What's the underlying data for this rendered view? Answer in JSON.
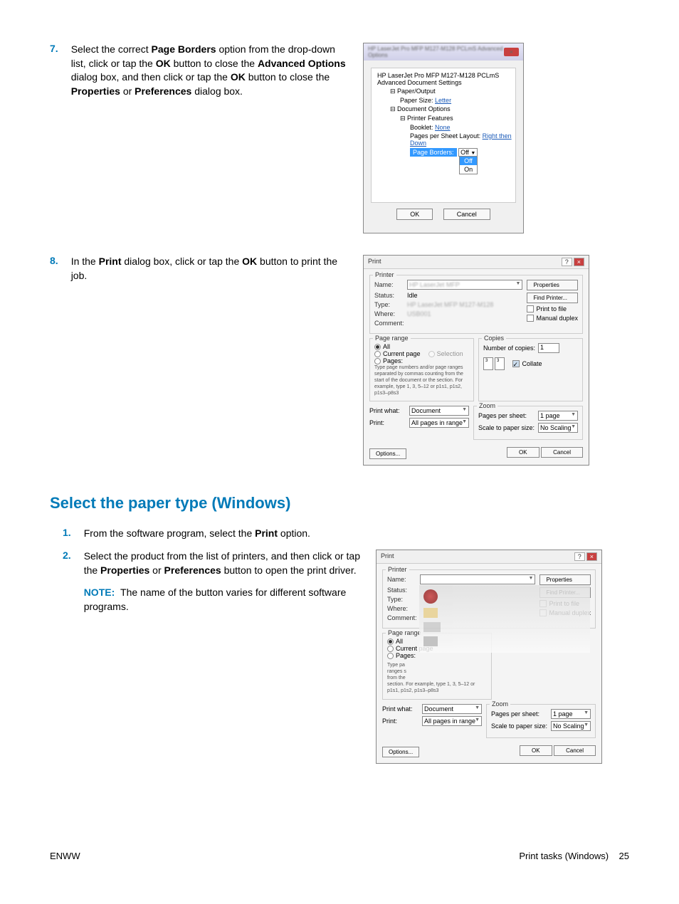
{
  "step7": {
    "number": "7.",
    "text_parts": [
      "Select the correct ",
      "Page Borders",
      " option from the drop-down list, click or tap the ",
      "OK",
      " button to close the ",
      "Advanced Options",
      " dialog box, and then click or tap the ",
      "OK",
      " button to close the ",
      "Properties",
      " or ",
      "Preferences",
      " dialog box."
    ]
  },
  "step8": {
    "number": "8.",
    "text_parts": [
      "In the ",
      "Print",
      " dialog box, click or tap the ",
      "OK",
      " button to print the job."
    ]
  },
  "section_heading": "Select the paper type (Windows)",
  "step1": {
    "number": "1.",
    "text_parts": [
      "From the software program, select the ",
      "Print",
      " option."
    ]
  },
  "step2": {
    "number": "2.",
    "text_parts": [
      "Select the product from the list of printers, and then click or tap the ",
      "Properties",
      " or ",
      "Preferences",
      " button to open the print driver."
    ],
    "note_label": "NOTE:",
    "note_text": "The name of the button varies for different software programs."
  },
  "adv_dialog": {
    "title_blur": "HP LaserJet Pro MFP M127-M128 PCLmS Advanced Options",
    "tree_root": "HP LaserJet Pro MFP M127-M128 PCLmS Advanced Document Settings",
    "paper_output": "Paper/Output",
    "paper_size_label": "Paper Size:",
    "paper_size_value": "Letter",
    "doc_options": "Document Options",
    "printer_features": "Printer Features",
    "booklet_label": "Booklet:",
    "booklet_value": "None",
    "pps_label": "Pages per Sheet Layout:",
    "pps_value": "Right then Down",
    "page_borders_label": "Page Borders:",
    "page_borders_selected": "Off",
    "page_borders_options": [
      "Off",
      "On"
    ],
    "ok": "OK",
    "cancel": "Cancel"
  },
  "print_dialog": {
    "title": "Print",
    "printer_section": "Printer",
    "name_label": "Name:",
    "status_label": "Status:",
    "status_value": "Idle",
    "type_label": "Type:",
    "where_label": "Where:",
    "comment_label": "Comment:",
    "properties_btn": "Properties",
    "find_printer_btn": "Find Printer...",
    "print_to_file": "Print to file",
    "manual_duplex": "Manual duplex",
    "page_range_section": "Page range",
    "all_label": "All",
    "current_page": "Current page",
    "selection": "Selection",
    "pages_label": "Pages:",
    "pages_hint": "Type page numbers and/or page ranges separated by commas counting from the start of the document or the section. For example, type 1, 3, 5–12 or p1s1, p1s2, p1s3–p8s3",
    "copies_section": "Copies",
    "copies_label": "Number of copies:",
    "copies_value": "1",
    "collate": "Collate",
    "print_what_label": "Print what:",
    "print_what_value": "Document",
    "print_label": "Print:",
    "print_value": "All pages in range",
    "zoom_section": "Zoom",
    "pages_per_sheet_label": "Pages per sheet:",
    "pages_per_sheet_value": "1 page",
    "scale_label": "Scale to paper size:",
    "scale_value": "No Scaling",
    "options_btn": "Options...",
    "ok": "OK",
    "cancel": "Cancel"
  },
  "print_dialog2": {
    "pages_hint_partial": "section. For example, type 1, 3, 5–12\nor p1s1, p1s2, p1s3–p8s3"
  },
  "footer": {
    "left": "ENWW",
    "right_label": "Print tasks (Windows)",
    "page": "25"
  }
}
